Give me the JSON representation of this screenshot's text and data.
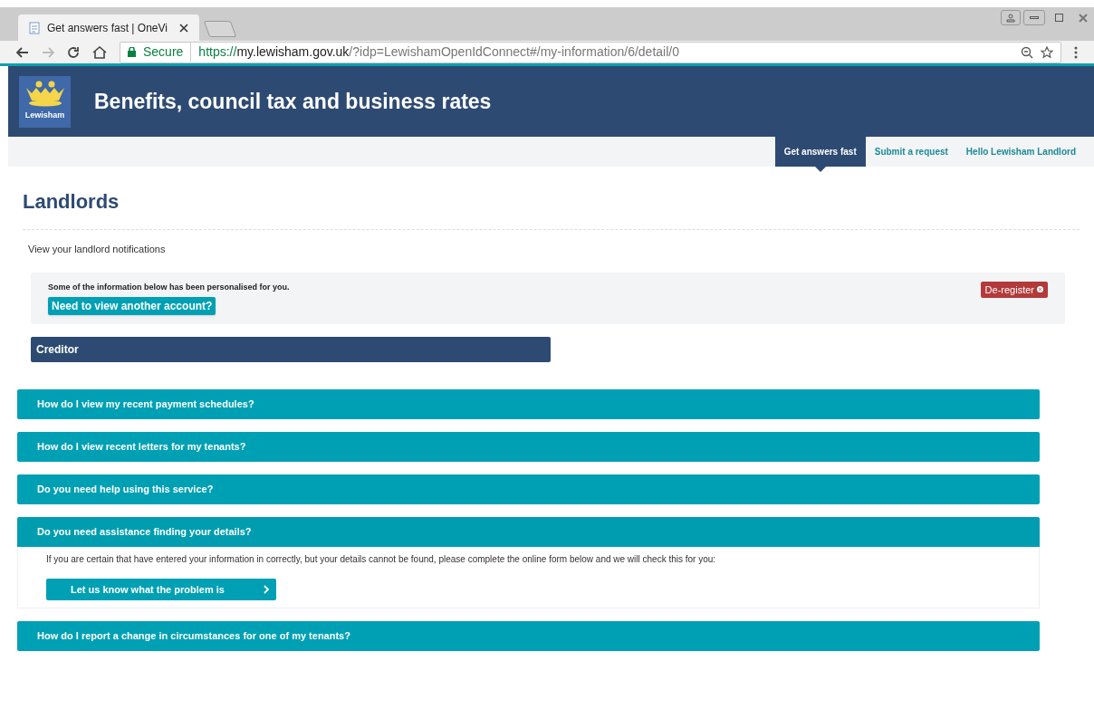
{
  "browser": {
    "tab_title": "Get answers fast | OneVi",
    "address": {
      "security": "Secure",
      "scheme": "https://",
      "host": "my.lewisham.gov.uk",
      "path": "/?idp=LewishamOpenIdConnect#/my-information/6/detail/0"
    }
  },
  "header": {
    "logo_text": "Lewisham",
    "title": "Benefits, council tax and business rates"
  },
  "nav": [
    {
      "label": "Get answers fast",
      "selected": true
    },
    {
      "label": "Submit a request",
      "selected": false
    },
    {
      "label": "Hello Lewisham Landlord",
      "selected": false
    }
  ],
  "page": {
    "heading": "Landlords",
    "intro": "View your landlord notifications"
  },
  "notice": {
    "text": "Some of the information below has been personalised for you.",
    "link": "Need to view another account?",
    "deregister": "De-register"
  },
  "creditor": {
    "title": "Creditor"
  },
  "faq": [
    {
      "question": "How do I view my recent payment schedules?",
      "expanded": false
    },
    {
      "question": "How do I view recent letters for my tenants?",
      "expanded": false
    },
    {
      "question": "Do you need help using this service?",
      "expanded": false
    },
    {
      "question": "Do you need assistance finding your details?",
      "expanded": true,
      "body": "If you are certain that have entered your information in correctly, but your details cannot be found, please complete the online form below and we will check this for you:",
      "button": "Let us know what the problem is"
    },
    {
      "question": "How do I report a change in circumstances for one of my tenants?",
      "expanded": false
    }
  ]
}
